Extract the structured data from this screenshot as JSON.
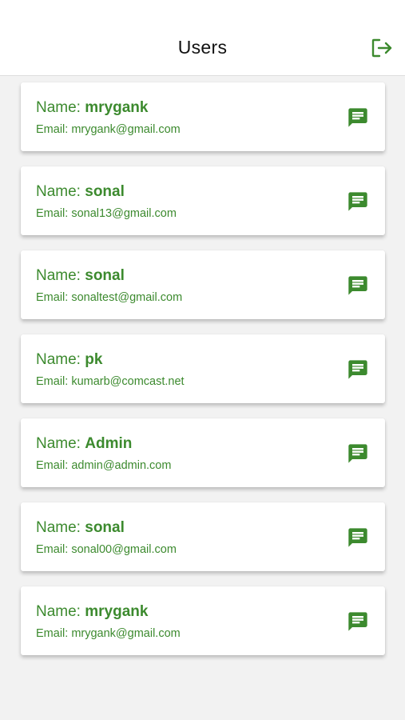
{
  "header": {
    "title": "Users",
    "logout_icon": "logout-icon"
  },
  "colors": {
    "accent": "#3c8a2e",
    "background": "#f2f2f2",
    "card": "#ffffff"
  },
  "labels": {
    "name_prefix": "Name: ",
    "email_prefix": "Email: "
  },
  "users": [
    {
      "name": "mrygank",
      "email": "mrygank@gmail.com",
      "action_icon": "chat-icon"
    },
    {
      "name": "sonal",
      "email": "sonal13@gmail.com",
      "action_icon": "chat-icon"
    },
    {
      "name": "sonal",
      "email": "sonaltest@gmail.com",
      "action_icon": "chat-icon"
    },
    {
      "name": "pk",
      "email": "kumarb@comcast.net",
      "action_icon": "chat-icon"
    },
    {
      "name": "Admin",
      "email": "admin@admin.com",
      "action_icon": "chat-icon"
    },
    {
      "name": "sonal",
      "email": "sonal00@gmail.com",
      "action_icon": "chat-icon"
    },
    {
      "name": "mrygank",
      "email": "mrygank@gmail.com",
      "action_icon": "chat-icon"
    }
  ]
}
